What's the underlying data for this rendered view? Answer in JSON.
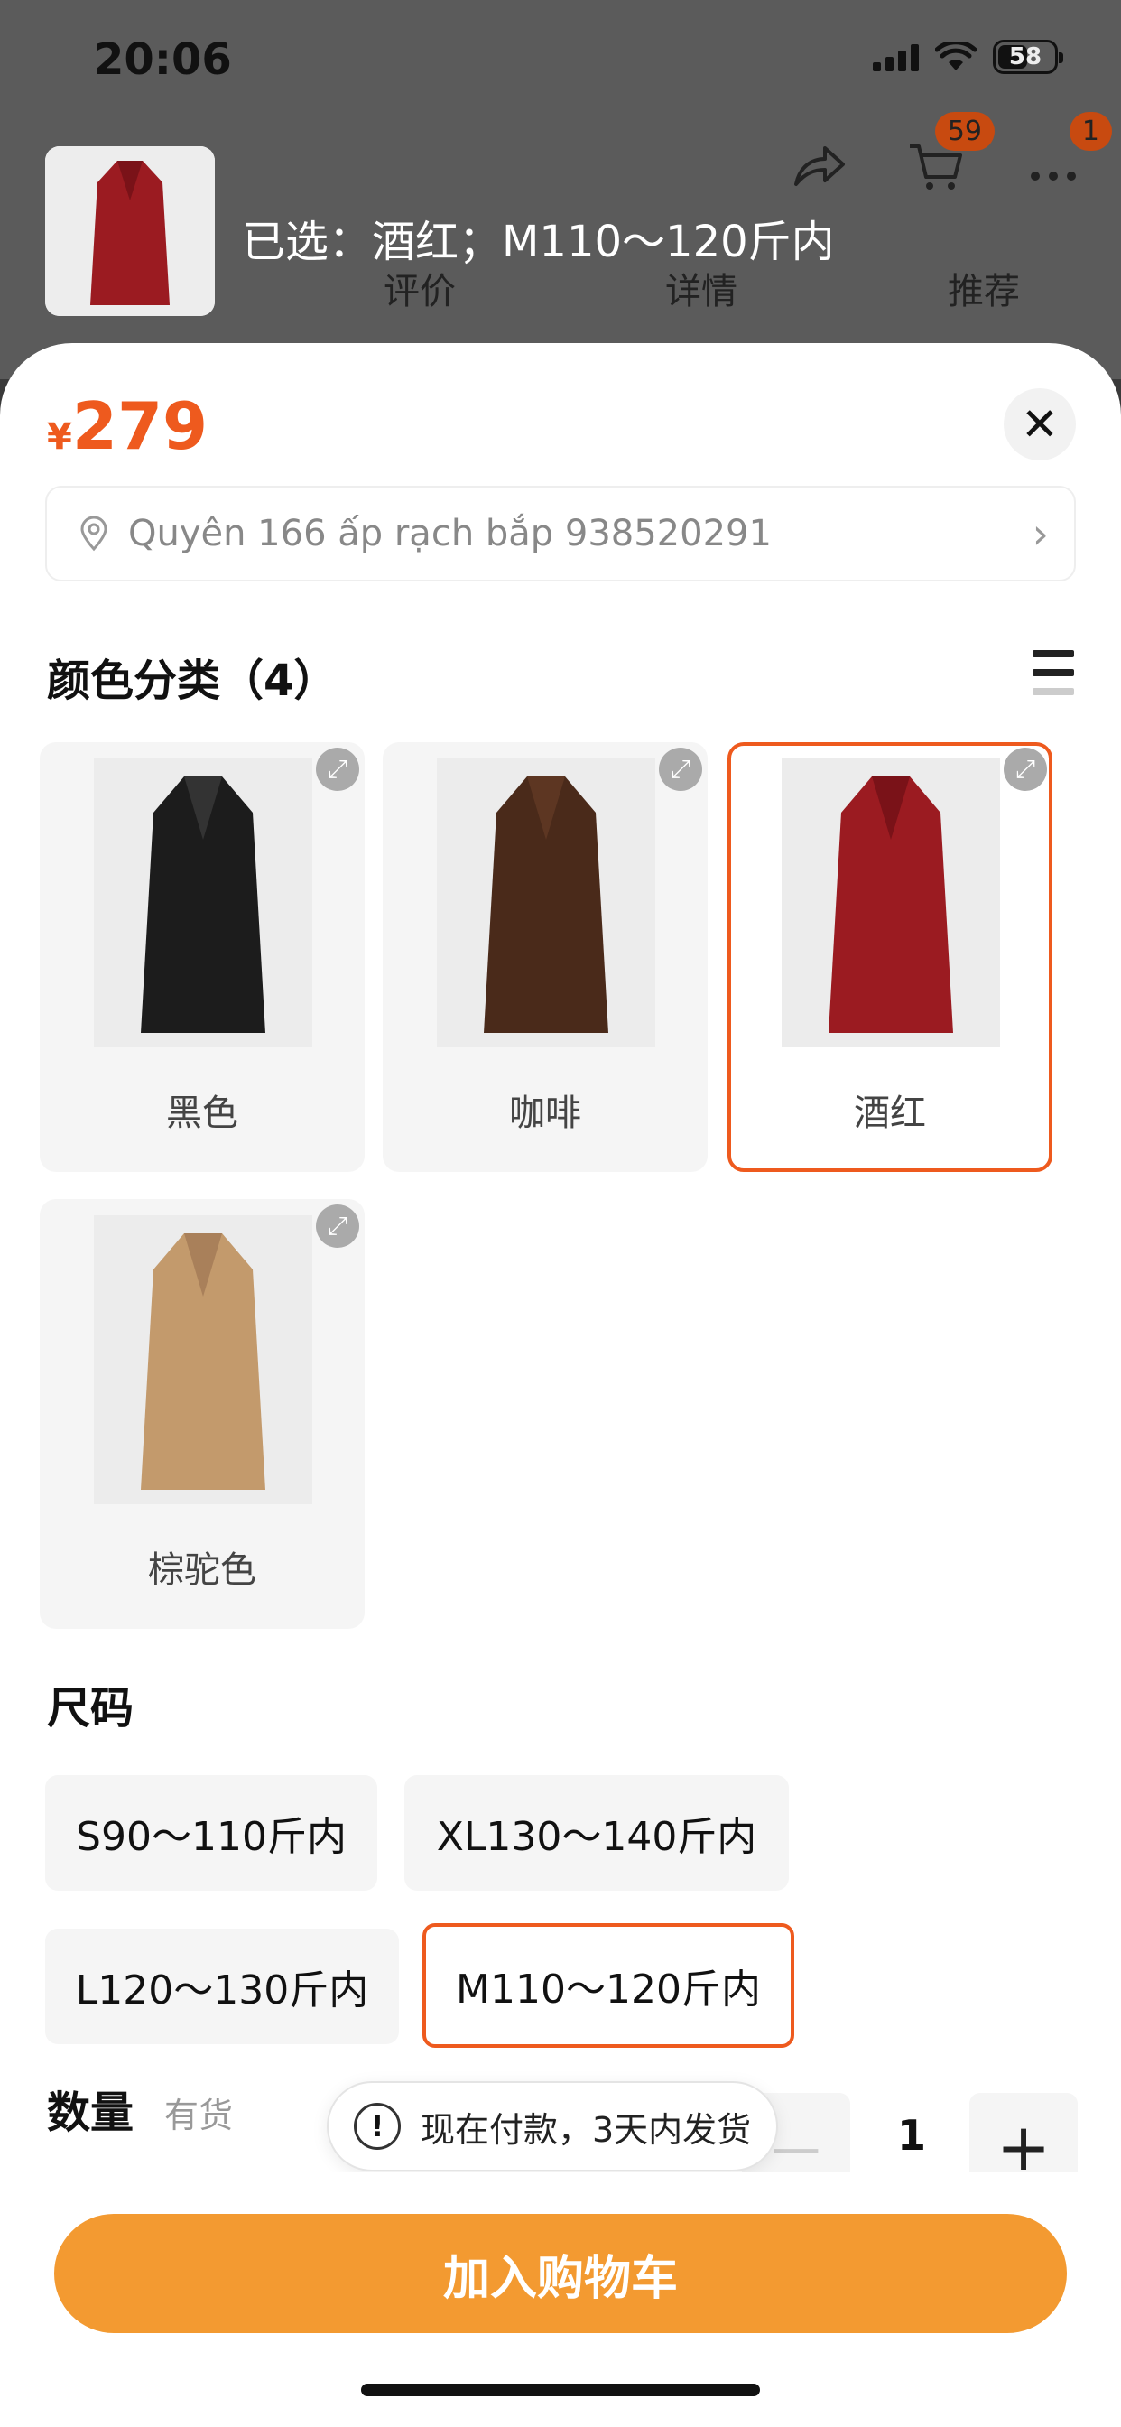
{
  "status_bar": {
    "time": "20:06",
    "battery": "58"
  },
  "nav": {
    "cart_badge": "59",
    "more_badge": "1",
    "tabs": [
      "评价",
      "详情",
      "推荐"
    ]
  },
  "selection": {
    "summary": "已选：酒红；M110～120斤内"
  },
  "product": {
    "currency": "¥",
    "price": "279"
  },
  "address": {
    "text": "Quyên 166 ấp rạch bắp 938520291"
  },
  "colors": {
    "title": "颜色分类（4）",
    "options": [
      {
        "label": "黑色",
        "color": "#1c1c1c"
      },
      {
        "label": "咖啡",
        "color": "#4a2a1a"
      },
      {
        "label": "酒红",
        "color": "#9b1b21"
      },
      {
        "label": "棕驼色",
        "color": "#c39a6c"
      }
    ],
    "selected": "酒红"
  },
  "sizes": {
    "title": "尺码",
    "options": [
      "S90～110斤内",
      "XL130～140斤内",
      "L120～130斤内",
      "M110～120斤内"
    ],
    "selected": "M110～120斤内"
  },
  "quantity": {
    "title": "数量",
    "stock": "有货",
    "value": "1"
  },
  "tooltip": {
    "text": "现在付款，3天内发货"
  },
  "actions": {
    "add_to_cart": "加入购物车"
  },
  "accent_color": "#ee5a1e",
  "button_color": "#f39a31"
}
